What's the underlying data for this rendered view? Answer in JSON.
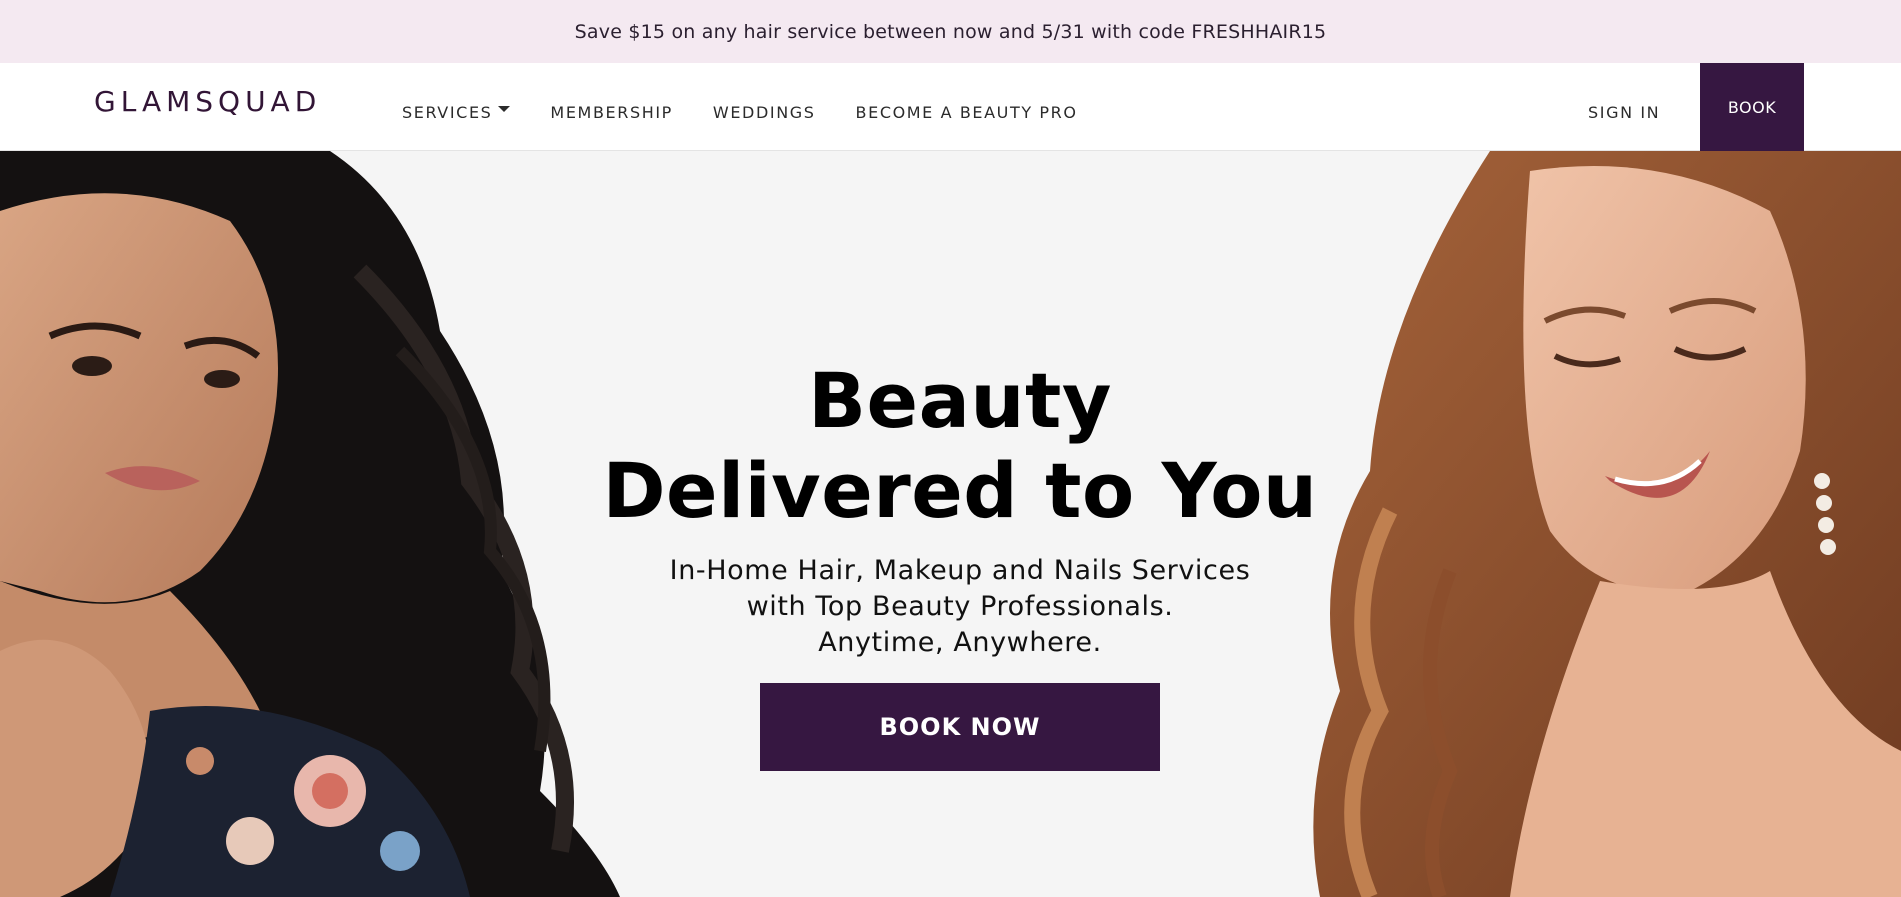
{
  "promo": {
    "text": "Save $15 on any hair service between now and 5/31 with code FRESHHAIR15"
  },
  "nav": {
    "logo": "GLAMSQUAD",
    "links": [
      {
        "label": "SERVICES",
        "has_dropdown": true
      },
      {
        "label": "MEMBERSHIP"
      },
      {
        "label": "WEDDINGS"
      },
      {
        "label": "BECOME A BEAUTY PRO"
      }
    ],
    "sign_in": "SIGN IN",
    "book": "BOOK"
  },
  "hero": {
    "title": "Beauty Delivered to You",
    "subtitle_lines": [
      "In-Home Hair, Makeup and Nails Services",
      "with Top Beauty Professionals.",
      "Anytime, Anywhere."
    ],
    "cta": "BOOK NOW"
  },
  "colors": {
    "brand": "#361741",
    "promo_bg": "#f4e9f1",
    "hero_bg": "#f5f5f5"
  }
}
